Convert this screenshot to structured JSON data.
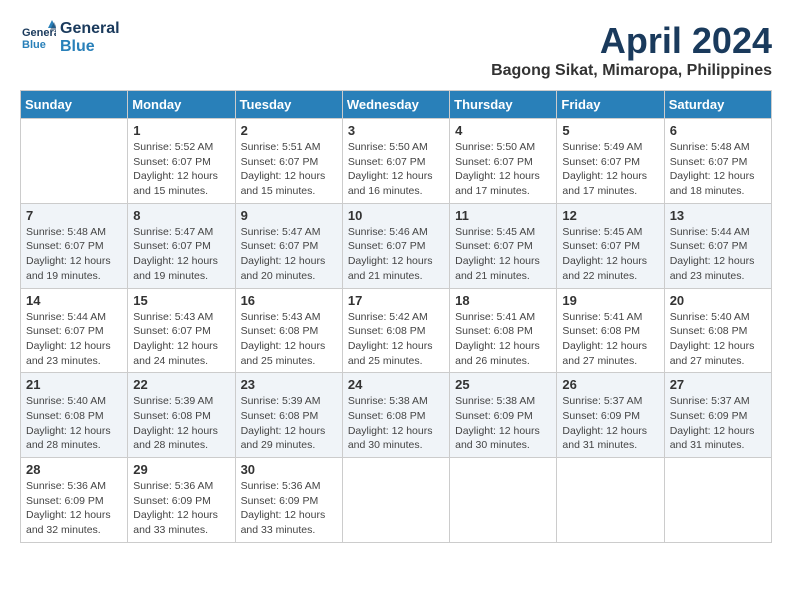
{
  "header": {
    "logo_line1": "General",
    "logo_line2": "Blue",
    "month": "April 2024",
    "location": "Bagong Sikat, Mimaropa, Philippines"
  },
  "calendar": {
    "days_of_week": [
      "Sunday",
      "Monday",
      "Tuesday",
      "Wednesday",
      "Thursday",
      "Friday",
      "Saturday"
    ],
    "weeks": [
      [
        {
          "day": "",
          "sunrise": "",
          "sunset": "",
          "daylight": ""
        },
        {
          "day": "1",
          "sunrise": "Sunrise: 5:52 AM",
          "sunset": "Sunset: 6:07 PM",
          "daylight": "Daylight: 12 hours and 15 minutes."
        },
        {
          "day": "2",
          "sunrise": "Sunrise: 5:51 AM",
          "sunset": "Sunset: 6:07 PM",
          "daylight": "Daylight: 12 hours and 15 minutes."
        },
        {
          "day": "3",
          "sunrise": "Sunrise: 5:50 AM",
          "sunset": "Sunset: 6:07 PM",
          "daylight": "Daylight: 12 hours and 16 minutes."
        },
        {
          "day": "4",
          "sunrise": "Sunrise: 5:50 AM",
          "sunset": "Sunset: 6:07 PM",
          "daylight": "Daylight: 12 hours and 17 minutes."
        },
        {
          "day": "5",
          "sunrise": "Sunrise: 5:49 AM",
          "sunset": "Sunset: 6:07 PM",
          "daylight": "Daylight: 12 hours and 17 minutes."
        },
        {
          "day": "6",
          "sunrise": "Sunrise: 5:48 AM",
          "sunset": "Sunset: 6:07 PM",
          "daylight": "Daylight: 12 hours and 18 minutes."
        }
      ],
      [
        {
          "day": "7",
          "sunrise": "Sunrise: 5:48 AM",
          "sunset": "Sunset: 6:07 PM",
          "daylight": "Daylight: 12 hours and 19 minutes."
        },
        {
          "day": "8",
          "sunrise": "Sunrise: 5:47 AM",
          "sunset": "Sunset: 6:07 PM",
          "daylight": "Daylight: 12 hours and 19 minutes."
        },
        {
          "day": "9",
          "sunrise": "Sunrise: 5:47 AM",
          "sunset": "Sunset: 6:07 PM",
          "daylight": "Daylight: 12 hours and 20 minutes."
        },
        {
          "day": "10",
          "sunrise": "Sunrise: 5:46 AM",
          "sunset": "Sunset: 6:07 PM",
          "daylight": "Daylight: 12 hours and 21 minutes."
        },
        {
          "day": "11",
          "sunrise": "Sunrise: 5:45 AM",
          "sunset": "Sunset: 6:07 PM",
          "daylight": "Daylight: 12 hours and 21 minutes."
        },
        {
          "day": "12",
          "sunrise": "Sunrise: 5:45 AM",
          "sunset": "Sunset: 6:07 PM",
          "daylight": "Daylight: 12 hours and 22 minutes."
        },
        {
          "day": "13",
          "sunrise": "Sunrise: 5:44 AM",
          "sunset": "Sunset: 6:07 PM",
          "daylight": "Daylight: 12 hours and 23 minutes."
        }
      ],
      [
        {
          "day": "14",
          "sunrise": "Sunrise: 5:44 AM",
          "sunset": "Sunset: 6:07 PM",
          "daylight": "Daylight: 12 hours and 23 minutes."
        },
        {
          "day": "15",
          "sunrise": "Sunrise: 5:43 AM",
          "sunset": "Sunset: 6:07 PM",
          "daylight": "Daylight: 12 hours and 24 minutes."
        },
        {
          "day": "16",
          "sunrise": "Sunrise: 5:43 AM",
          "sunset": "Sunset: 6:08 PM",
          "daylight": "Daylight: 12 hours and 25 minutes."
        },
        {
          "day": "17",
          "sunrise": "Sunrise: 5:42 AM",
          "sunset": "Sunset: 6:08 PM",
          "daylight": "Daylight: 12 hours and 25 minutes."
        },
        {
          "day": "18",
          "sunrise": "Sunrise: 5:41 AM",
          "sunset": "Sunset: 6:08 PM",
          "daylight": "Daylight: 12 hours and 26 minutes."
        },
        {
          "day": "19",
          "sunrise": "Sunrise: 5:41 AM",
          "sunset": "Sunset: 6:08 PM",
          "daylight": "Daylight: 12 hours and 27 minutes."
        },
        {
          "day": "20",
          "sunrise": "Sunrise: 5:40 AM",
          "sunset": "Sunset: 6:08 PM",
          "daylight": "Daylight: 12 hours and 27 minutes."
        }
      ],
      [
        {
          "day": "21",
          "sunrise": "Sunrise: 5:40 AM",
          "sunset": "Sunset: 6:08 PM",
          "daylight": "Daylight: 12 hours and 28 minutes."
        },
        {
          "day": "22",
          "sunrise": "Sunrise: 5:39 AM",
          "sunset": "Sunset: 6:08 PM",
          "daylight": "Daylight: 12 hours and 28 minutes."
        },
        {
          "day": "23",
          "sunrise": "Sunrise: 5:39 AM",
          "sunset": "Sunset: 6:08 PM",
          "daylight": "Daylight: 12 hours and 29 minutes."
        },
        {
          "day": "24",
          "sunrise": "Sunrise: 5:38 AM",
          "sunset": "Sunset: 6:08 PM",
          "daylight": "Daylight: 12 hours and 30 minutes."
        },
        {
          "day": "25",
          "sunrise": "Sunrise: 5:38 AM",
          "sunset": "Sunset: 6:09 PM",
          "daylight": "Daylight: 12 hours and 30 minutes."
        },
        {
          "day": "26",
          "sunrise": "Sunrise: 5:37 AM",
          "sunset": "Sunset: 6:09 PM",
          "daylight": "Daylight: 12 hours and 31 minutes."
        },
        {
          "day": "27",
          "sunrise": "Sunrise: 5:37 AM",
          "sunset": "Sunset: 6:09 PM",
          "daylight": "Daylight: 12 hours and 31 minutes."
        }
      ],
      [
        {
          "day": "28",
          "sunrise": "Sunrise: 5:36 AM",
          "sunset": "Sunset: 6:09 PM",
          "daylight": "Daylight: 12 hours and 32 minutes."
        },
        {
          "day": "29",
          "sunrise": "Sunrise: 5:36 AM",
          "sunset": "Sunset: 6:09 PM",
          "daylight": "Daylight: 12 hours and 33 minutes."
        },
        {
          "day": "30",
          "sunrise": "Sunrise: 5:36 AM",
          "sunset": "Sunset: 6:09 PM",
          "daylight": "Daylight: 12 hours and 33 minutes."
        },
        {
          "day": "",
          "sunrise": "",
          "sunset": "",
          "daylight": ""
        },
        {
          "day": "",
          "sunrise": "",
          "sunset": "",
          "daylight": ""
        },
        {
          "day": "",
          "sunrise": "",
          "sunset": "",
          "daylight": ""
        },
        {
          "day": "",
          "sunrise": "",
          "sunset": "",
          "daylight": ""
        }
      ]
    ]
  }
}
